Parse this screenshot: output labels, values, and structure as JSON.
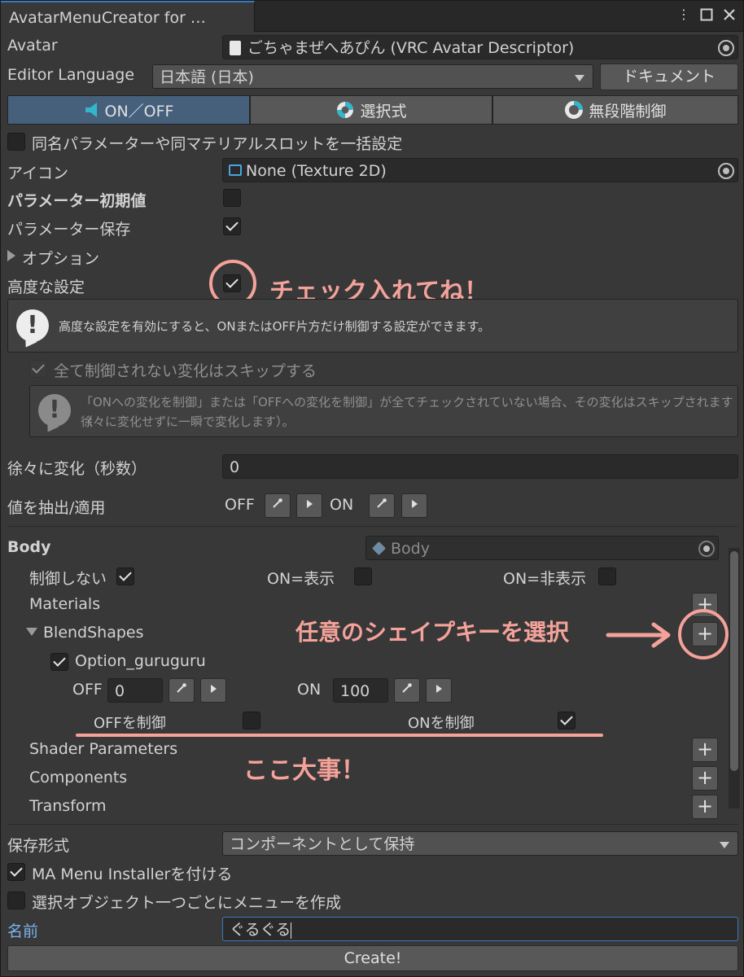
{
  "window": {
    "tab_title": "AvatarMenuCreator for …"
  },
  "colors": {
    "accent": "#3a79bb",
    "annotation": "#f4a29a",
    "panel": "#383838",
    "active_tab": "#46607c"
  },
  "header": {
    "avatar_label": "Avatar",
    "avatar_value": "ごちゃまぜへあぴん (VRC Avatar Descriptor)",
    "language_label": "Editor Language",
    "language_value": "日本語 (日本)",
    "doc_button": "ドキュメント"
  },
  "modes": [
    {
      "label": "ON／OFF",
      "icon": "on-off-icon",
      "active": true
    },
    {
      "label": "選択式",
      "icon": "lifebuoy-icon",
      "active": false
    },
    {
      "label": "無段階制御",
      "icon": "ring-icon",
      "active": false
    }
  ],
  "settings": {
    "batch_label": "同名パラメーターや同マテリアルスロットを一括設定",
    "icon_label": "アイコン",
    "icon_value": "None (Texture 2D)",
    "param_default_label": "パラメーター初期値",
    "param_save_label": "パラメーター保存",
    "options_label": "オプション",
    "advanced_label": "高度な設定",
    "help1": "高度な設定を有効にすると、ONまたはOFF片方だけ制御する設定ができます。",
    "skip_label": "全て制御されない変化はスキップする",
    "help2_line1": "「ONへの変化を制御」または「OFFへの変化を制御」が全てチェックされていない場合、その変化はスキップされます（",
    "help2_line2": "徐々に変化せずに一瞬で変化します）。",
    "gradual_label": "徐々に変化（秒数）",
    "gradual_value": "0",
    "extract_label": "値を抽出/適用",
    "off_label": "OFF",
    "on_label": "ON"
  },
  "body": {
    "title": "Body",
    "object_value": "Body",
    "no_control": "制御しない",
    "on_show": "ON=表示",
    "on_hide": "ON=非表示",
    "materials": "Materials",
    "blendshapes": "BlendShapes",
    "shape_name": "Option_guruguru",
    "off_label": "OFF",
    "off_value": "0",
    "on_label": "ON",
    "on_value": "100",
    "off_control": "OFFを制御",
    "on_control": "ONを制御",
    "shader_params": "Shader Parameters",
    "components": "Components",
    "transform": "Transform"
  },
  "footer": {
    "save_format_label": "保存形式",
    "save_format_value": "コンポーネントとして保持",
    "ma_installer": "MA Menu Installerを付ける",
    "per_object": "選択オブジェクト一つごとにメニューを作成",
    "name_label": "名前",
    "name_value": "ぐるぐる",
    "create_button": "Create!"
  },
  "annotations": {
    "check_note": "チェック入れてね！",
    "select_note": "任意のシェイプキーを選択",
    "important_note": "ここ大事！"
  }
}
